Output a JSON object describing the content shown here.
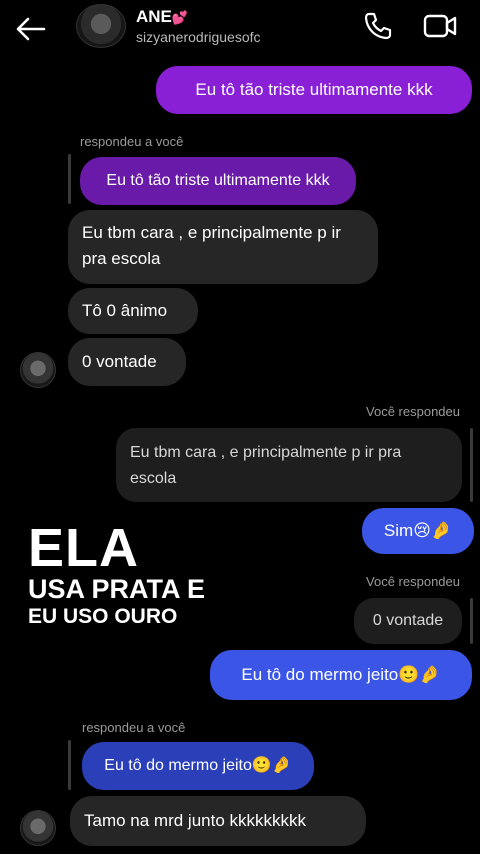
{
  "header": {
    "name": "ANE",
    "name_emoji": "💕",
    "username": "sizyanerodriguesofc",
    "icons": [
      "back-arrow-icon",
      "phone-icon",
      "video-icon"
    ]
  },
  "messages": {
    "m1": "Eu tô tão triste ultimamente kkk",
    "reply_label_1": "respondeu a você",
    "m2_quote": "Eu tô tão triste ultimamente kkk",
    "m3": "Eu tbm cara , e principalmente p ir pra escola",
    "m4": "Tô 0 ânimo",
    "m5": "0 vontade",
    "you_replied_1": "Você respondeu",
    "m6_quote": "Eu tbm cara , e principalmente p ir pra escola",
    "m7": "Sim",
    "m7_emoji": "😢🤌",
    "you_replied_2": "Você respondeu",
    "m8_quote": "0 vontade",
    "m9": "Eu tô do mermo jeito",
    "m9_emoji": "🙂🤌",
    "reply_label_2": "respondeu a você",
    "m10_quote": "Eu tô do mermo jeito",
    "m10_emoji": "🙂🤌",
    "m11": "Tamo na mrd junto kkkkkkkkk"
  },
  "overlay": {
    "line1": "ELA",
    "line2": "USA PRATA E",
    "line3": "EU USO OURO"
  },
  "colors": {
    "background": "#000000",
    "sent_purple": "#8a20d6",
    "sent_blue": "#3b56e6",
    "received": "#262626"
  }
}
